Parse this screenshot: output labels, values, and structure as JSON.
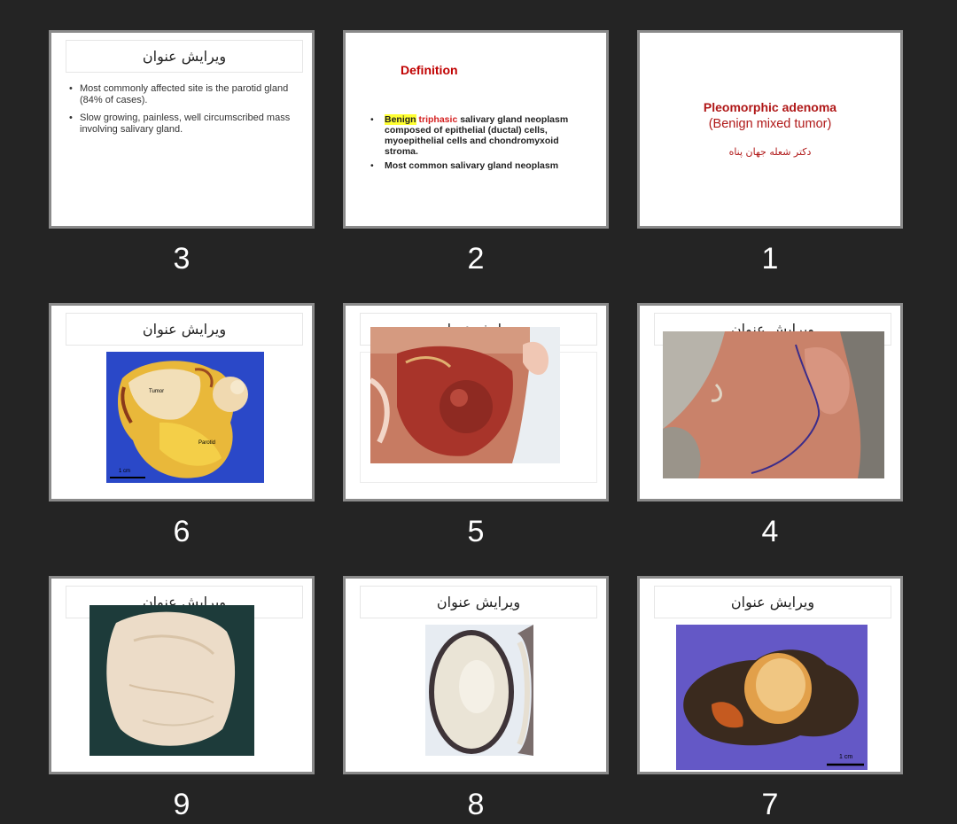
{
  "grid": {
    "slides": [
      {
        "number": "3",
        "title": "ویرایش عنوان",
        "bullets": [
          "Most commonly affected site is the parotid gland (84% of cases).",
          "Slow growing, painless, well circumscribed mass involving salivary gland."
        ]
      },
      {
        "number": "2",
        "heading": "Definition",
        "bullet1": {
          "highlight": "Benign",
          "accent": "triphasic",
          "rest": " salivary gland neoplasm composed of epithelial (ductal) cells, myoepithelial cells and chondromyxoid stroma."
        },
        "bullet2": "Most common salivary gland neoplasm"
      },
      {
        "number": "1",
        "title": "Pleomorphic adenoma",
        "subtitle": "(Benign mixed tumor)",
        "author": "دکتر شعله جهان پناه"
      },
      {
        "number": "6",
        "title": "ویرایش عنوان",
        "labels": {
          "tumor": "Tumor",
          "parotid": "Parotid",
          "scale": "1 cm"
        }
      },
      {
        "number": "5",
        "title": "ویرایش عنوان"
      },
      {
        "number": "4",
        "title": "ویرایش عنوان"
      },
      {
        "number": "9",
        "title": "ویرایش عنوان"
      },
      {
        "number": "8",
        "title": "ویرایش عنوان"
      },
      {
        "number": "7",
        "title": "ویرایش عنوان",
        "labels": {
          "scale": "1 cm"
        }
      }
    ]
  },
  "colors": {
    "background": "#242424",
    "slide_border": "#8a8a8a",
    "accent_red": "#c00000",
    "highlight": "#ffff33"
  }
}
